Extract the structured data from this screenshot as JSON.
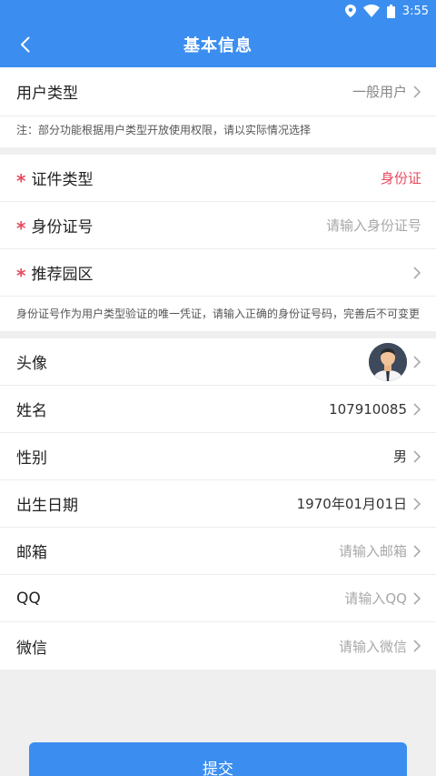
{
  "status_bar": {
    "time": "3:55"
  },
  "navbar": {
    "title": "基本信息"
  },
  "user_type": {
    "label": "用户类型",
    "value": "一般用户"
  },
  "note1": "注：部分功能根据用户类型开放使用权限，请以实际情况选择",
  "id_section": {
    "cert_type": {
      "label": "证件类型",
      "value": "身份证"
    },
    "id_number": {
      "label": "身份证号",
      "placeholder": "请输入身份证号"
    },
    "park": {
      "label": "推荐园区",
      "value": ""
    },
    "note": "身份证号作为用户类型验证的唯一凭证，请输入正确的身份证号码，完善后不可变更"
  },
  "profile": {
    "avatar": {
      "label": "头像"
    },
    "name": {
      "label": "姓名",
      "value": "107910085"
    },
    "gender": {
      "label": "性别",
      "value": "男"
    },
    "birthday": {
      "label": "出生日期",
      "value": "1970年01月01日"
    },
    "email": {
      "label": "邮箱",
      "placeholder": "请输入邮箱"
    },
    "qq": {
      "label": "QQ",
      "placeholder": "请输入QQ"
    },
    "wechat": {
      "label": "微信",
      "placeholder": "请输入微信"
    }
  },
  "submit_label": "提交",
  "colors": {
    "primary": "#3b8ef0",
    "required": "#e84a5f"
  }
}
